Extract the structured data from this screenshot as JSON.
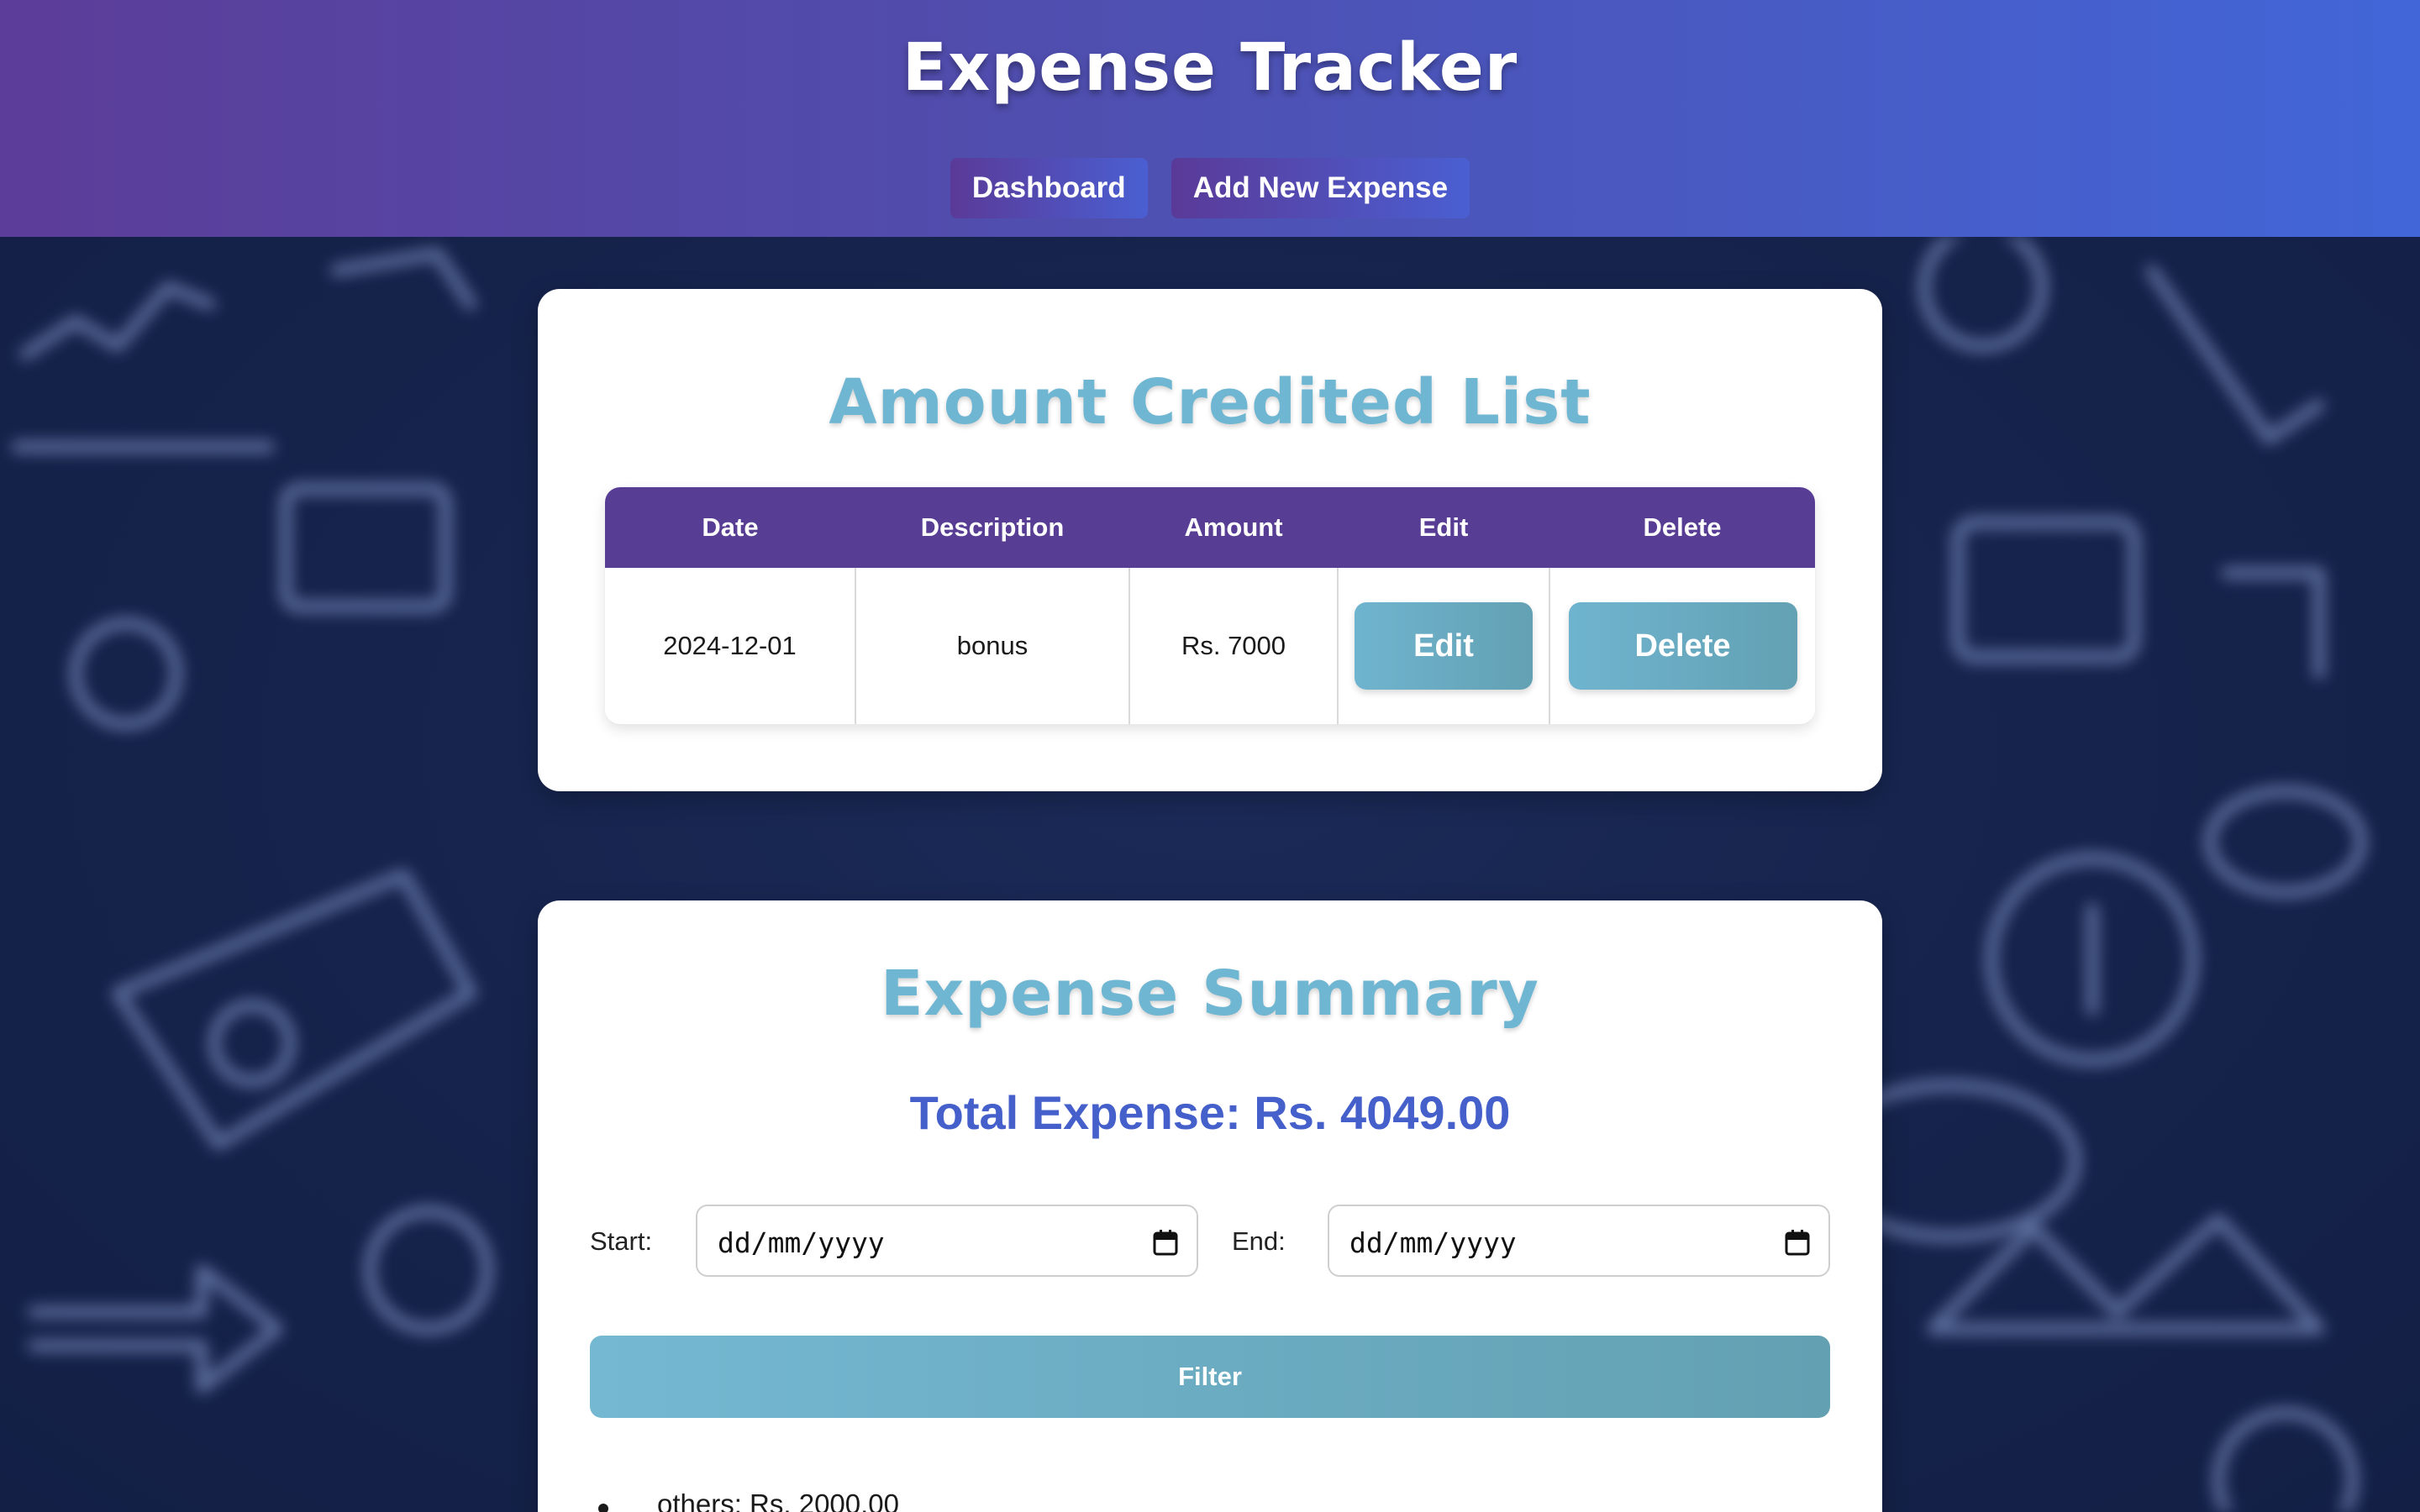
{
  "header": {
    "title": "Expense Tracker",
    "nav": [
      {
        "label": "Dashboard"
      },
      {
        "label": "Add New Expense"
      }
    ]
  },
  "credited": {
    "title": "Amount Credited List",
    "columns": [
      "Date",
      "Description",
      "Amount",
      "Edit",
      "Delete"
    ],
    "rows": [
      {
        "date": "2024-12-01",
        "description": "bonus",
        "amount": "Rs. 7000",
        "edit_label": "Edit",
        "delete_label": "Delete"
      }
    ]
  },
  "summary": {
    "title": "Expense Summary",
    "total": "Total Expense: Rs. 4049.00",
    "start_label": "Start:",
    "end_label": "End:",
    "start_placeholder": "dd/mm/yyyy",
    "end_placeholder": "dd/mm/yyyy",
    "filter_label": "Filter",
    "items": [
      "others: Rs. 2000.00"
    ]
  },
  "colors": {
    "header_start": "#5c3d99",
    "header_end": "#4266d8",
    "table_header": "#573d93",
    "accent_title": "#6fb6d2",
    "total_text": "#4560cb",
    "button": "#6fb4cf"
  }
}
